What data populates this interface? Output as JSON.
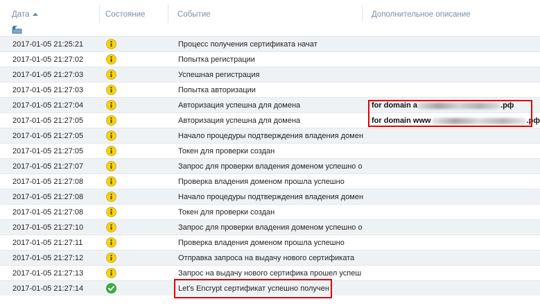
{
  "columns": {
    "date": "Дата",
    "state": "Состояние",
    "event": "Событие",
    "description": "Дополнительное описание"
  },
  "rows": [
    {
      "date": "2017-01-05 21:25:21",
      "status": "warning",
      "event": "Процесс получения сертификата начат",
      "desc_prefix": "",
      "desc_suffix": ""
    },
    {
      "date": "2017-01-05 21:27:02",
      "status": "warning",
      "event": "Попытка регистрации",
      "desc_prefix": "",
      "desc_suffix": ""
    },
    {
      "date": "2017-01-05 21:27:03",
      "status": "warning",
      "event": "Успешная регистрация",
      "desc_prefix": "",
      "desc_suffix": ""
    },
    {
      "date": "2017-01-05 21:27:03",
      "status": "warning",
      "event": "Попытка авторизации",
      "desc_prefix": "",
      "desc_suffix": ""
    },
    {
      "date": "2017-01-05 21:27:04",
      "status": "warning",
      "event": "Авторизация успешна для домена",
      "desc_prefix": "for domain a",
      "desc_suffix": ".рф"
    },
    {
      "date": "2017-01-05 21:27:05",
      "status": "warning",
      "event": "Авторизация успешна для домена",
      "desc_prefix": "for domain www",
      "desc_suffix": ".рф"
    },
    {
      "date": "2017-01-05 21:27:05",
      "status": "warning",
      "event": "Начало процедуры подтверждения владения домен",
      "desc_prefix": "",
      "desc_suffix": ""
    },
    {
      "date": "2017-01-05 21:27:05",
      "status": "warning",
      "event": "Токен для проверки создан",
      "desc_prefix": "",
      "desc_suffix": ""
    },
    {
      "date": "2017-01-05 21:27:07",
      "status": "warning",
      "event": "Запрос для проверки владения доменом успешно о",
      "desc_prefix": "",
      "desc_suffix": ""
    },
    {
      "date": "2017-01-05 21:27:08",
      "status": "warning",
      "event": "Проверка владения доменом прошла успешно",
      "desc_prefix": "",
      "desc_suffix": ""
    },
    {
      "date": "2017-01-05 21:27:08",
      "status": "warning",
      "event": "Начало процедуры подтверждения владения домен",
      "desc_prefix": "",
      "desc_suffix": ""
    },
    {
      "date": "2017-01-05 21:27:08",
      "status": "warning",
      "event": "Токен для проверки создан",
      "desc_prefix": "",
      "desc_suffix": ""
    },
    {
      "date": "2017-01-05 21:27:10",
      "status": "warning",
      "event": "Запрос для проверки владения доменом успешно о",
      "desc_prefix": "",
      "desc_suffix": ""
    },
    {
      "date": "2017-01-05 21:27:11",
      "status": "warning",
      "event": "Проверка владения доменом прошла успешно",
      "desc_prefix": "",
      "desc_suffix": ""
    },
    {
      "date": "2017-01-05 21:27:12",
      "status": "warning",
      "event": "Отправка запроса на выдачу нового сертификата",
      "desc_prefix": "",
      "desc_suffix": ""
    },
    {
      "date": "2017-01-05 21:27:13",
      "status": "warning",
      "event": "Запрос на выдачу нового сертифика прошел успеш",
      "desc_prefix": "",
      "desc_suffix": ""
    },
    {
      "date": "2017-01-05 21:27:14",
      "status": "success",
      "event": "Let's Encrypt сертификат успешно получен",
      "desc_prefix": "",
      "desc_suffix": ""
    }
  ],
  "colors": {
    "header_text": "#7b8fa6",
    "row_shade": "#eff2f5",
    "highlight": "#e00000",
    "warning_icon": "#f3d21a",
    "success_icon": "#3cb043"
  },
  "icons": {
    "up": "folder-up-icon",
    "warning": "warning-info-icon",
    "success": "success-check-icon"
  }
}
